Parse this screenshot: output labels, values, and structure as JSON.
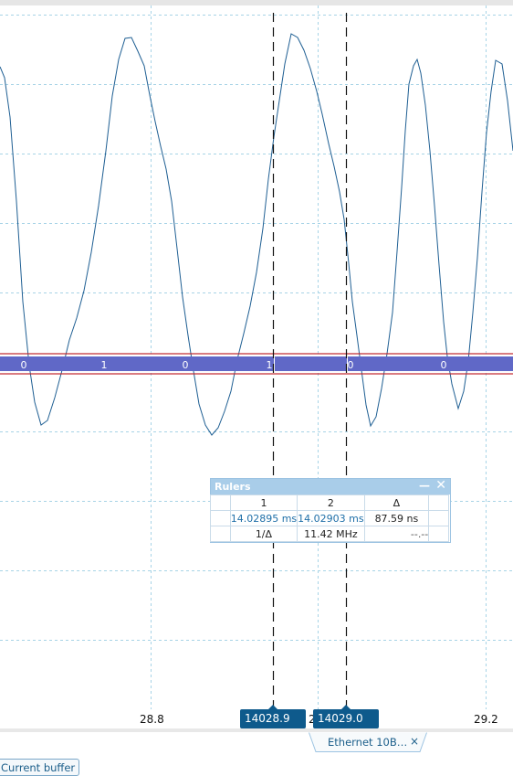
{
  "x_axis": {
    "tick_labels": [
      "28.8",
      "29.2"
    ],
    "partial_label": "2"
  },
  "decoder_bits": [
    "0",
    "1",
    "0",
    "1",
    "0",
    "0"
  ],
  "rulers": [
    {
      "label": "14028.9 µs"
    },
    {
      "label": "14029.0 µs"
    }
  ],
  "rulers_panel": {
    "title": "Rulers",
    "minimize_symbol": "—",
    "close_symbol": "✕",
    "header": [
      "1",
      "2",
      "Δ"
    ],
    "row1": [
      "14.02895 ms",
      "14.02903 ms",
      "87.59 ns"
    ],
    "row2": [
      "1/Δ",
      "11.42 MHz",
      "--.--"
    ]
  },
  "tab": {
    "label": "Ethernet 10B…",
    "close_symbol": "×"
  },
  "buffer_button": {
    "label": "Current buffer"
  },
  "colors": {
    "waveform": "#1f5f93",
    "grid": "#a7d3e6",
    "decoder_bar": "#6068c7",
    "decoder_outline": "#c0262d",
    "ruler": "#111111",
    "accent": "#0e5a8c"
  }
}
